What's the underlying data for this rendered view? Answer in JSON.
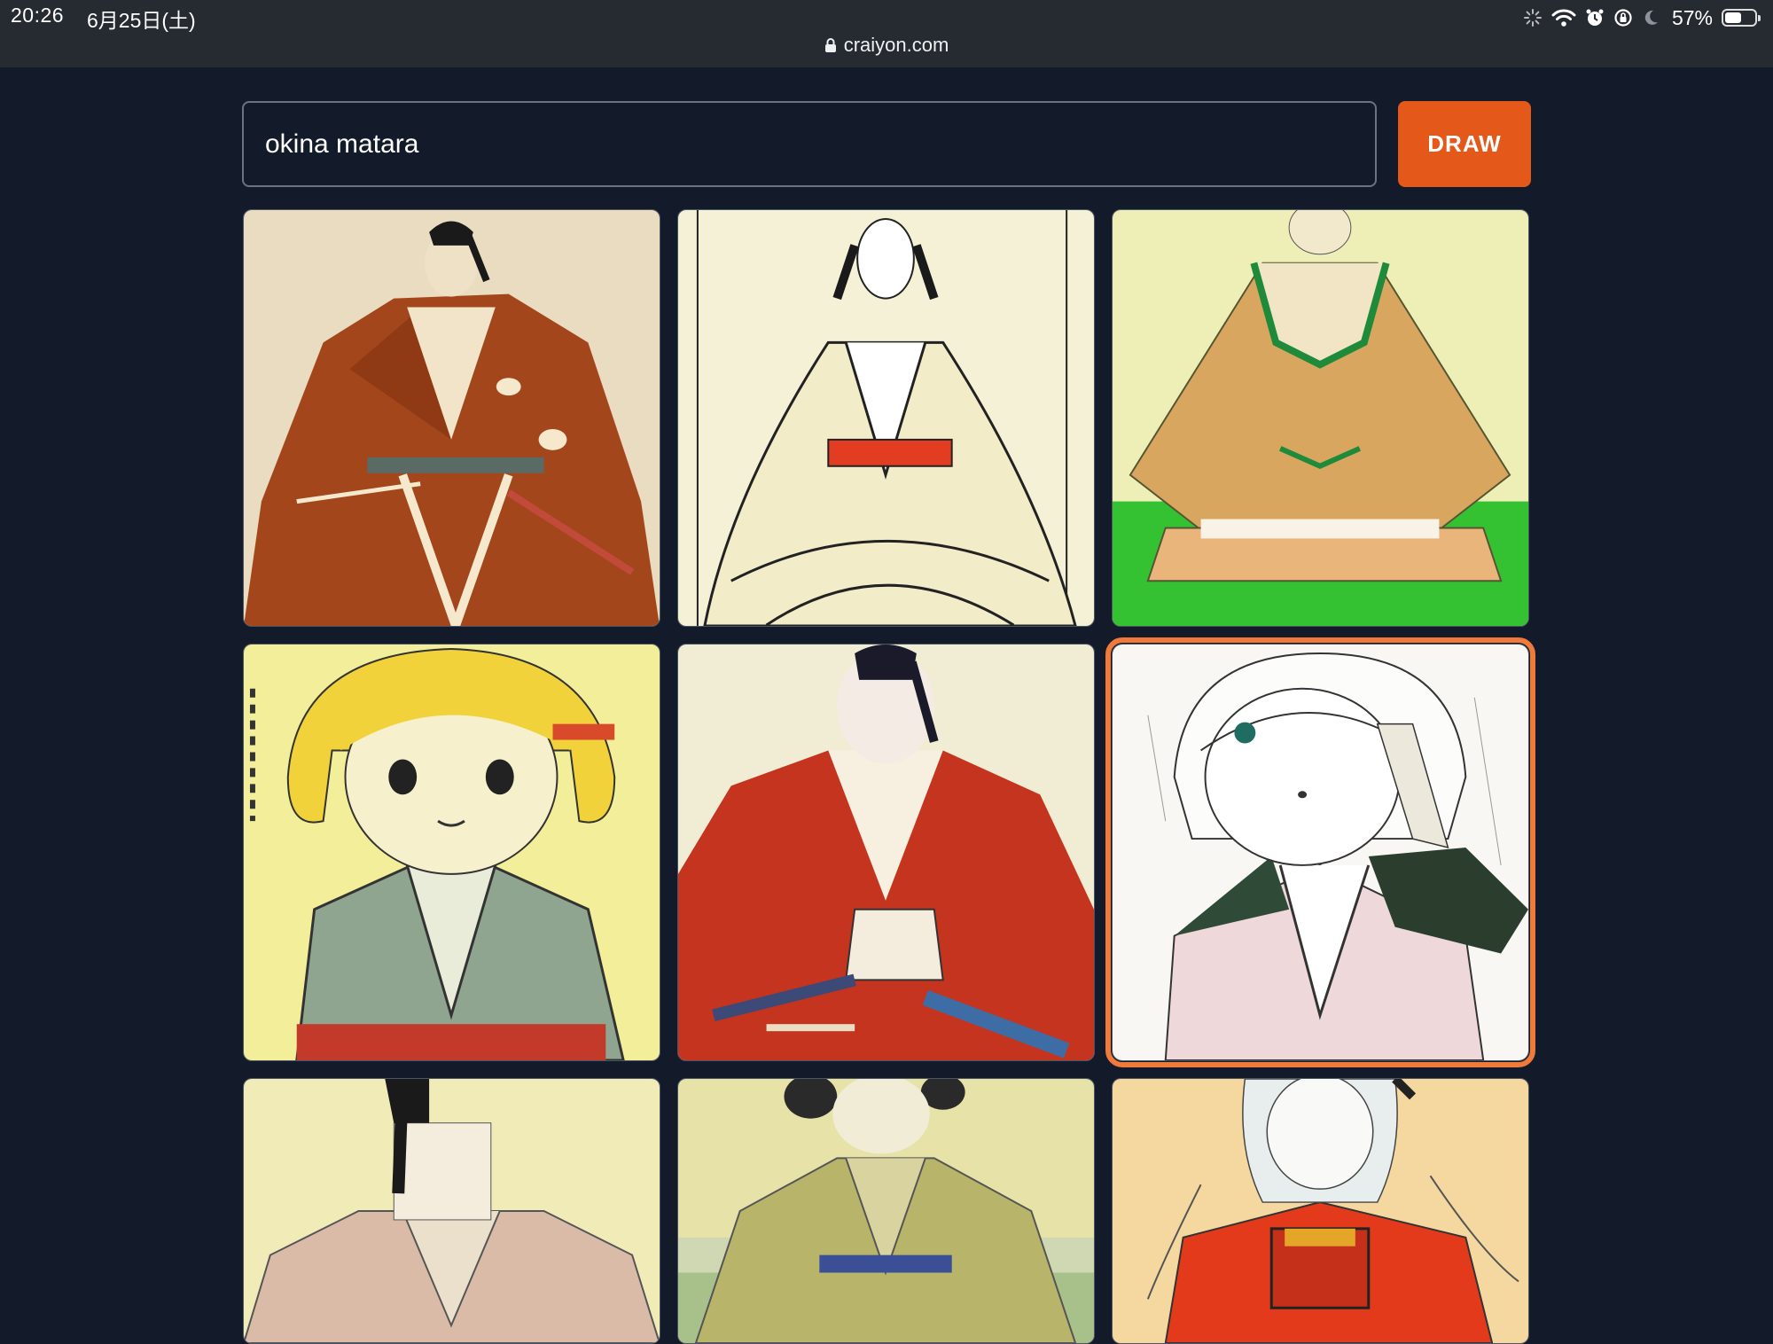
{
  "status_bar": {
    "time": "20:26",
    "date": "6月25日(土)",
    "url": "craiyon.com",
    "battery_percent": "57%",
    "battery_level": 0.57,
    "icons": [
      "loading-spinner-icon",
      "wifi-icon",
      "alarm-icon",
      "orientation-lock-icon",
      "moon-icon",
      "battery-icon"
    ]
  },
  "search": {
    "value": "okina matara",
    "button_label": "DRAW"
  },
  "colors": {
    "background": "#131a29",
    "accent": "#e4581a",
    "selected_outline": "#f07a3a"
  },
  "gallery": {
    "selected_index": 5,
    "images": [
      {
        "subject": "man in brown kimono"
      },
      {
        "subject": "line sketch of figure in cream kimono with red sash"
      },
      {
        "subject": "figure in tan robe on green background"
      },
      {
        "subject": "anime girl with blonde hair in grey kimono"
      },
      {
        "subject": "man in red kimono"
      },
      {
        "subject": "anime girl sketch with dark patterned collar"
      },
      {
        "subject": "man in tan kimono"
      },
      {
        "subject": "figure in yellow-green kimono"
      },
      {
        "subject": "anime girl in red kimono"
      }
    ]
  }
}
